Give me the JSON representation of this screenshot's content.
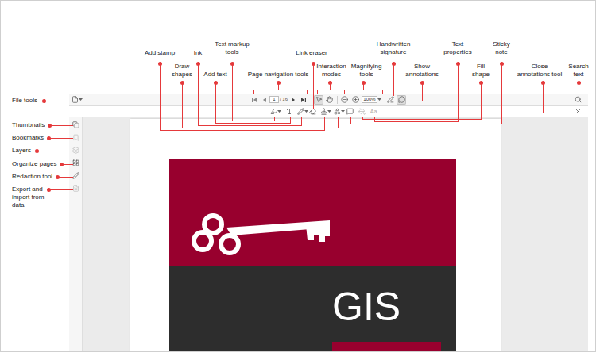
{
  "annotations": {
    "top": [
      {
        "label": "Add stamp"
      },
      {
        "label": "Draw\nshapes"
      },
      {
        "label": "Ink"
      },
      {
        "label": "Add text"
      },
      {
        "label": "Text markup\ntools"
      },
      {
        "label": "Page navigation tools"
      },
      {
        "label": "Link eraser"
      },
      {
        "label": "Interaction\nmodes"
      },
      {
        "label": "Handwritten\nsignature"
      },
      {
        "label": "Magnifying\ntools"
      },
      {
        "label": "Show\nannotations"
      },
      {
        "label": "Text\nproperties"
      },
      {
        "label": "Sticky\nnote"
      },
      {
        "label": "Fill\nshape"
      },
      {
        "label": "Close\nannotations tool"
      },
      {
        "label": "Search\ntext"
      }
    ],
    "left": [
      {
        "label": "File tools"
      },
      {
        "label": "Thumbnails"
      },
      {
        "label": "Bookmarks"
      },
      {
        "label": "Layers"
      },
      {
        "label": "Organize pages"
      },
      {
        "label": "Redaction tool"
      },
      {
        "label": "Export and\nimport from\ndata"
      }
    ]
  },
  "toolbar": {
    "page_input": "1",
    "page_count": "/ 16",
    "zoom": "100%",
    "interaction_modes": [
      {
        "selected": true
      },
      {
        "selected": false
      }
    ],
    "show_annotations": {
      "selected": true
    }
  },
  "annotation_toolbar": {
    "text_properties": {
      "text": "Aa",
      "disabled": true
    },
    "fill_shape": {
      "disabled": true
    }
  },
  "sidebar": {
    "items": [
      {
        "disabled": false
      },
      {
        "disabled": true
      },
      {
        "disabled": true
      },
      {
        "disabled": false
      },
      {
        "disabled": false
      },
      {
        "disabled": true
      }
    ]
  },
  "document": {
    "cover_title": "GIS"
  }
}
